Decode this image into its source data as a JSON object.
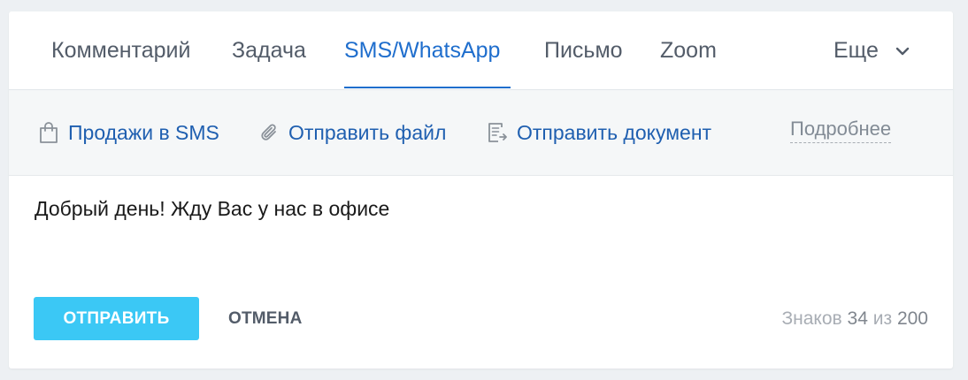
{
  "tabs": {
    "items": [
      {
        "label": "Комментарий"
      },
      {
        "label": "Задача"
      },
      {
        "label": "SMS/WhatsApp"
      },
      {
        "label": "Письмо"
      },
      {
        "label": "Zoom"
      }
    ],
    "active": "SMS/WhatsApp",
    "more_label": "Еще",
    "more_icon": "chevron-down-icon"
  },
  "toolbar": {
    "sales_sms": {
      "label": "Продажи в SMS",
      "icon": "shopping-bag-icon"
    },
    "send_file": {
      "label": "Отправить файл",
      "icon": "paperclip-icon"
    },
    "send_document": {
      "label": "Отправить документ",
      "icon": "document-icon"
    },
    "more_link": "Подробнее"
  },
  "message": {
    "text": "Добрый день! Жду Вас у нас в офисе"
  },
  "actions": {
    "send_label": "ОТПРАВИТЬ",
    "cancel_label": "ОТМЕНА"
  },
  "counter": {
    "prefix": "Знаков",
    "count": "34",
    "separator": "из",
    "max": "200"
  },
  "colors": {
    "accent": "#1f6ecd",
    "link": "#1f5fb0",
    "send_button": "#3bc8f5",
    "toolbar_bg": "#f5f7f8",
    "page_bg": "#edf0f3"
  }
}
